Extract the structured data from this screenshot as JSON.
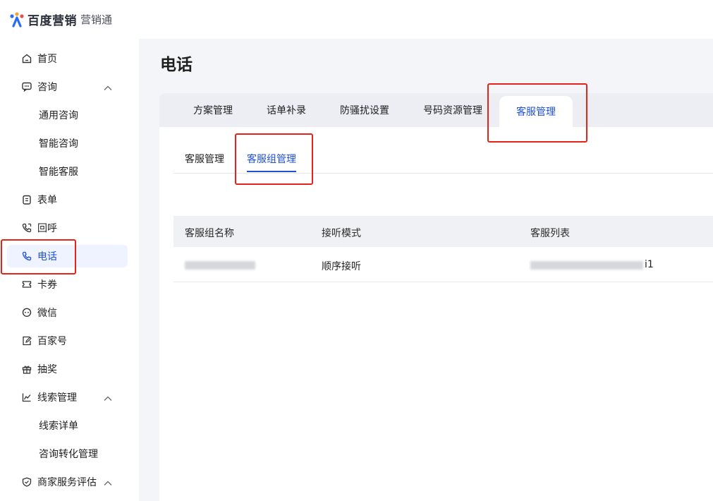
{
  "brand": {
    "name": "百度营销",
    "product": "营销通",
    "colors": {
      "blue": "#2b6cf6",
      "orange": "#f2a43a",
      "red": "#e85141"
    }
  },
  "sidebar": {
    "items": [
      {
        "label": "首页",
        "icon": "home-icon"
      },
      {
        "label": "咨询",
        "icon": "chat-bubble-icon",
        "expanded": true
      },
      {
        "label": "通用咨询",
        "sub": true
      },
      {
        "label": "智能咨询",
        "sub": true
      },
      {
        "label": "智能客服",
        "sub": true
      },
      {
        "label": "表单",
        "icon": "form-icon"
      },
      {
        "label": "回呼",
        "icon": "callback-phone-icon"
      },
      {
        "label": "电话",
        "icon": "phone-icon",
        "active": true
      },
      {
        "label": "卡券",
        "icon": "coupon-icon"
      },
      {
        "label": "微信",
        "icon": "wechat-icon"
      },
      {
        "label": "百家号",
        "icon": "edit-icon"
      },
      {
        "label": "抽奖",
        "icon": "gift-icon"
      },
      {
        "label": "线索管理",
        "icon": "chart-icon",
        "expanded": true
      },
      {
        "label": "线索详单",
        "sub": true
      },
      {
        "label": "咨询转化管理",
        "sub": true
      },
      {
        "label": "商家服务评估",
        "icon": "shield-icon",
        "expanded": true
      }
    ]
  },
  "page": {
    "title": "电话"
  },
  "tabs": [
    {
      "label": "方案管理"
    },
    {
      "label": "话单补录"
    },
    {
      "label": "防骚扰设置"
    },
    {
      "label": "号码资源管理"
    },
    {
      "label": "客服管理",
      "active": true
    }
  ],
  "subtabs": [
    {
      "label": "客服管理"
    },
    {
      "label": "客服组管理",
      "active": true
    }
  ],
  "table": {
    "columns": [
      "客服组名称",
      "接听模式",
      "客服列表"
    ],
    "rows": [
      {
        "mode": "顺序接听",
        "list_suffix": "i1"
      }
    ]
  },
  "colors": {
    "accent": "#1d4fd8",
    "annotation": "#e3241b"
  }
}
